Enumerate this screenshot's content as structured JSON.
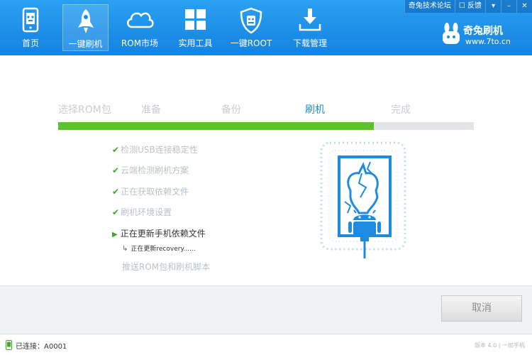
{
  "app": {
    "brand_name": "奇兔刷机",
    "brand_url": "www.7to.cn"
  },
  "topbar": {
    "forum_label": "奇兔技术论坛",
    "feedback_label": "反馈"
  },
  "nav": {
    "items": [
      {
        "label": "首页"
      },
      {
        "label": "一键刷机"
      },
      {
        "label": "ROM市场"
      },
      {
        "label": "实用工具"
      },
      {
        "label": "一键ROOT"
      },
      {
        "label": "下载管理"
      }
    ],
    "active_index": 1
  },
  "steps": [
    "选择ROM包",
    "准备",
    "备份",
    "刷机",
    "完成"
  ],
  "current_step_index": 3,
  "progress": {
    "fraction": 0.76
  },
  "tasks": {
    "done": [
      "检测USB连接稳定性",
      "云端检测刷机方案",
      "正在获取依赖文件",
      "刷机环境设置"
    ],
    "current": "正在更新手机依赖文件",
    "subtask": "正在更新recovery......",
    "pending": "推送ROM包和刷机脚本"
  },
  "footer": {
    "cancel_label": "取消"
  },
  "status": {
    "connection": "已连接：A0001",
    "right_text": "版本 4.0 | 一加手机"
  },
  "colors": {
    "header": "#1a8fe8",
    "progress": "#5cc22e",
    "accent": "#1f8be0"
  }
}
